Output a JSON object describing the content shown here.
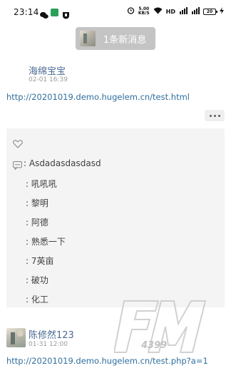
{
  "status_bar": {
    "time": "23:14",
    "net_speed_top": "5.00",
    "net_speed_bottom": "KB/S",
    "network_type": "HD",
    "battery": "20"
  },
  "notice": {
    "text": "1条新消息"
  },
  "post": {
    "author": "海绵宝宝",
    "time": "02-01 16:39",
    "link": "http://20201019.demo.hugelem.cn/test.html"
  },
  "comments": [
    {
      "text": ": Asdadasdasdasd"
    },
    {
      "text": ": 吼吼吼"
    },
    {
      "text": ": 黎明"
    },
    {
      "text": ": 阿德"
    },
    {
      "text": ": 熟悉一下"
    },
    {
      "text": ": 7英亩"
    },
    {
      "text": ": 破功"
    },
    {
      "text": ": 化工"
    }
  ],
  "post2": {
    "author": "陈修然123",
    "time": "01-31 12:00",
    "link": "http://20201019.demo.hugelem.cn/test.php?a=1"
  },
  "watermark": {
    "brand": "FM",
    "sub": "4399"
  },
  "colors": {
    "link": "#2f6f9f",
    "author": "#4a6a94",
    "notice_bg": "#c4c4c4",
    "comment_bg": "#f4f4f4"
  }
}
